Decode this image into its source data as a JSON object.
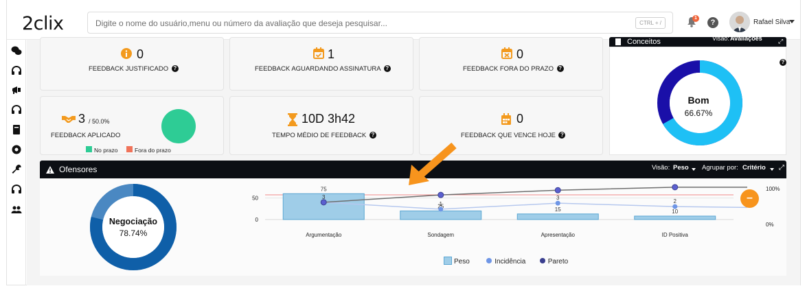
{
  "header": {
    "logo": "2clix",
    "search_placeholder": "Digite o nome do usuário,menu ou número da avaliação que deseja pesquisar...",
    "search_shortcut": "CTRL + /",
    "notification_count": "1",
    "help": "?",
    "user_name": "Rafael Silva"
  },
  "cards": {
    "justificado": {
      "value": "0",
      "label": "FEEDBACK JUSTIFICADO"
    },
    "aguardando": {
      "value": "1",
      "label": "FEEDBACK AGUARDANDO ASSINATURA"
    },
    "fora_prazo": {
      "value": "0",
      "label": "FEEDBACK FORA DO PRAZO"
    },
    "aplicado": {
      "value": "3",
      "sub": "/ 50.0%",
      "label": "FEEDBACK APLICADO",
      "legend_ok": "No prazo",
      "legend_late": "Fora do prazo",
      "legend_ok_color": "#2ecc95",
      "legend_late_color": "#f0735a"
    },
    "tempo_medio": {
      "value": "10D 3h42",
      "label": "TEMPO MÉDIO DE FEEDBACK"
    },
    "vence_hoje": {
      "value": "0",
      "label": "FEEDBACK QUE VENCE HOJE"
    }
  },
  "conceitos": {
    "title": "Conceitos",
    "visao_label": "Visão:",
    "visao_value": "Avaliações",
    "center_label": "Bom",
    "center_value": "66.67%",
    "fraction": 0.6667,
    "colors": {
      "main": "#1ec0f5",
      "second": "#1a0fa8"
    }
  },
  "ofensores": {
    "title": "Ofensores",
    "visao_label": "Visão:",
    "visao_value": "Peso",
    "agrupar_label": "Agrupar por:",
    "agrupar_value": "Critério",
    "donut_label": "Negociação",
    "donut_value": "78.74%",
    "donut_fraction": 0.7874
  },
  "chart_data": {
    "type": "bar",
    "categories": [
      "Argumentação",
      "Sondagem",
      "Apresentação",
      "ID Positiva"
    ],
    "ylim": [
      0,
      70
    ],
    "y_ticks": [
      "0",
      "50"
    ],
    "y2_ticks": [
      "0%",
      "100%"
    ],
    "series": [
      {
        "name": "Peso",
        "type": "bar",
        "values": [
          60,
          20,
          13,
          8
        ],
        "labels": [
          "75",
          "25",
          "15",
          "10"
        ],
        "color": "#9fcde8"
      },
      {
        "name": "Incidência",
        "type": "line",
        "values": [
          40,
          24,
          38,
          30
        ],
        "labels": [
          "3",
          "1",
          "3",
          "2"
        ],
        "color": "#6f96e6"
      },
      {
        "name": "Pareto",
        "type": "line",
        "values": [
          40,
          57,
          68,
          75
        ],
        "color": "#3a3f8f"
      }
    ],
    "legend_position": "bottom"
  }
}
